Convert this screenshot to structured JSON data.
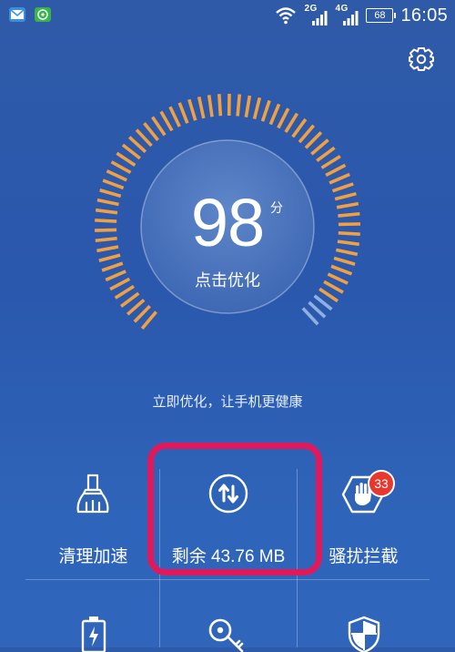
{
  "status_bar": {
    "network_1": "2G",
    "network_2": "4G",
    "battery": "68",
    "time": "16:05"
  },
  "main": {
    "score": "98",
    "score_unit": "分",
    "optimize_label": "点击优化",
    "tagline": "立即优化，让手机更健康"
  },
  "tiles": {
    "clean": {
      "label": "清理加速"
    },
    "traffic": {
      "label": "剩余 43.76 MB"
    },
    "harass": {
      "label": "骚扰拦截",
      "badge": "33"
    }
  },
  "colors": {
    "background": "#2b59ab",
    "gauge_ticks": "#f0a040",
    "highlight": "#e0195d",
    "badge": "#e8372d"
  },
  "icons": {
    "email": "email-icon",
    "wechat": "chat-app-icon",
    "wifi": "wifi-icon",
    "settings": "gear-icon",
    "broom": "broom-icon",
    "traffic": "data-traffic-icon",
    "hand": "hand-block-icon",
    "battery_tile": "battery-icon",
    "key": "key-icon",
    "shield": "shield-icon"
  }
}
